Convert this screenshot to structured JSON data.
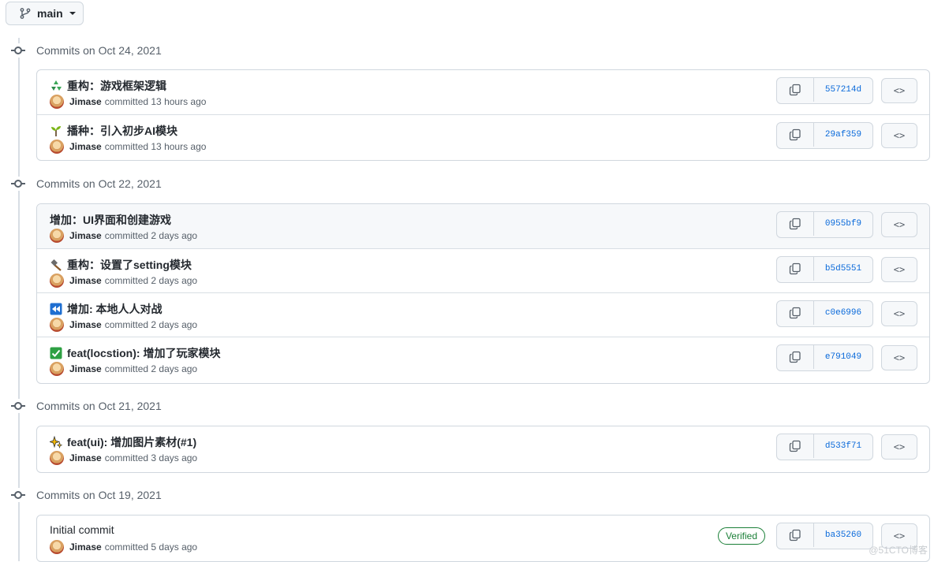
{
  "branch": {
    "label": "main"
  },
  "groups": [
    {
      "header": "Commits on Oct 24, 2021",
      "commits": [
        {
          "title": "重构：游戏框架逻辑",
          "emoji": "recycle-icon",
          "author": "Jimase",
          "meta": "committed 13 hours ago",
          "sha": "557214d"
        },
        {
          "title": "播种：引入初步AI模块",
          "emoji": "seedling-icon",
          "author": "Jimase",
          "meta": "committed 13 hours ago",
          "sha": "29af359"
        }
      ]
    },
    {
      "header": "Commits on Oct 22, 2021",
      "commits": [
        {
          "title": "增加：UI界面和创建游戏",
          "emoji": "",
          "author": "Jimase",
          "meta": "committed 2 days ago",
          "sha": "0955bf9"
        },
        {
          "title": "重构：设置了setting模块",
          "emoji": "hammer-icon",
          "author": "Jimase",
          "meta": "committed 2 days ago",
          "sha": "b5d5551"
        },
        {
          "title": "增加: 本地人人对战",
          "emoji": "rewind-icon",
          "author": "Jimase",
          "meta": "committed 2 days ago",
          "sha": "c0e6996"
        },
        {
          "title": "feat(locstion): 增加了玩家模块",
          "emoji": "check-icon",
          "author": "Jimase",
          "meta": "committed 2 days ago",
          "sha": "e791049"
        }
      ]
    },
    {
      "header": "Commits on Oct 21, 2021",
      "commits": [
        {
          "title": "feat(ui): 增加图片素材(#1)",
          "emoji": "sparkles-icon",
          "author": "Jimase",
          "meta": "committed 3 days ago",
          "sha": "d533f71"
        }
      ]
    },
    {
      "header": "Commits on Oct 19, 2021",
      "commits": [
        {
          "title": "Initial commit",
          "emoji": "",
          "author": "Jimase",
          "meta": "committed 5 days ago",
          "sha": "ba35260",
          "badge": "Verified"
        }
      ]
    }
  ],
  "watermark": "@51CTO博客",
  "colors": {
    "link": "#0969da",
    "verified": "#1a7f37",
    "border": "#d0d7de"
  }
}
